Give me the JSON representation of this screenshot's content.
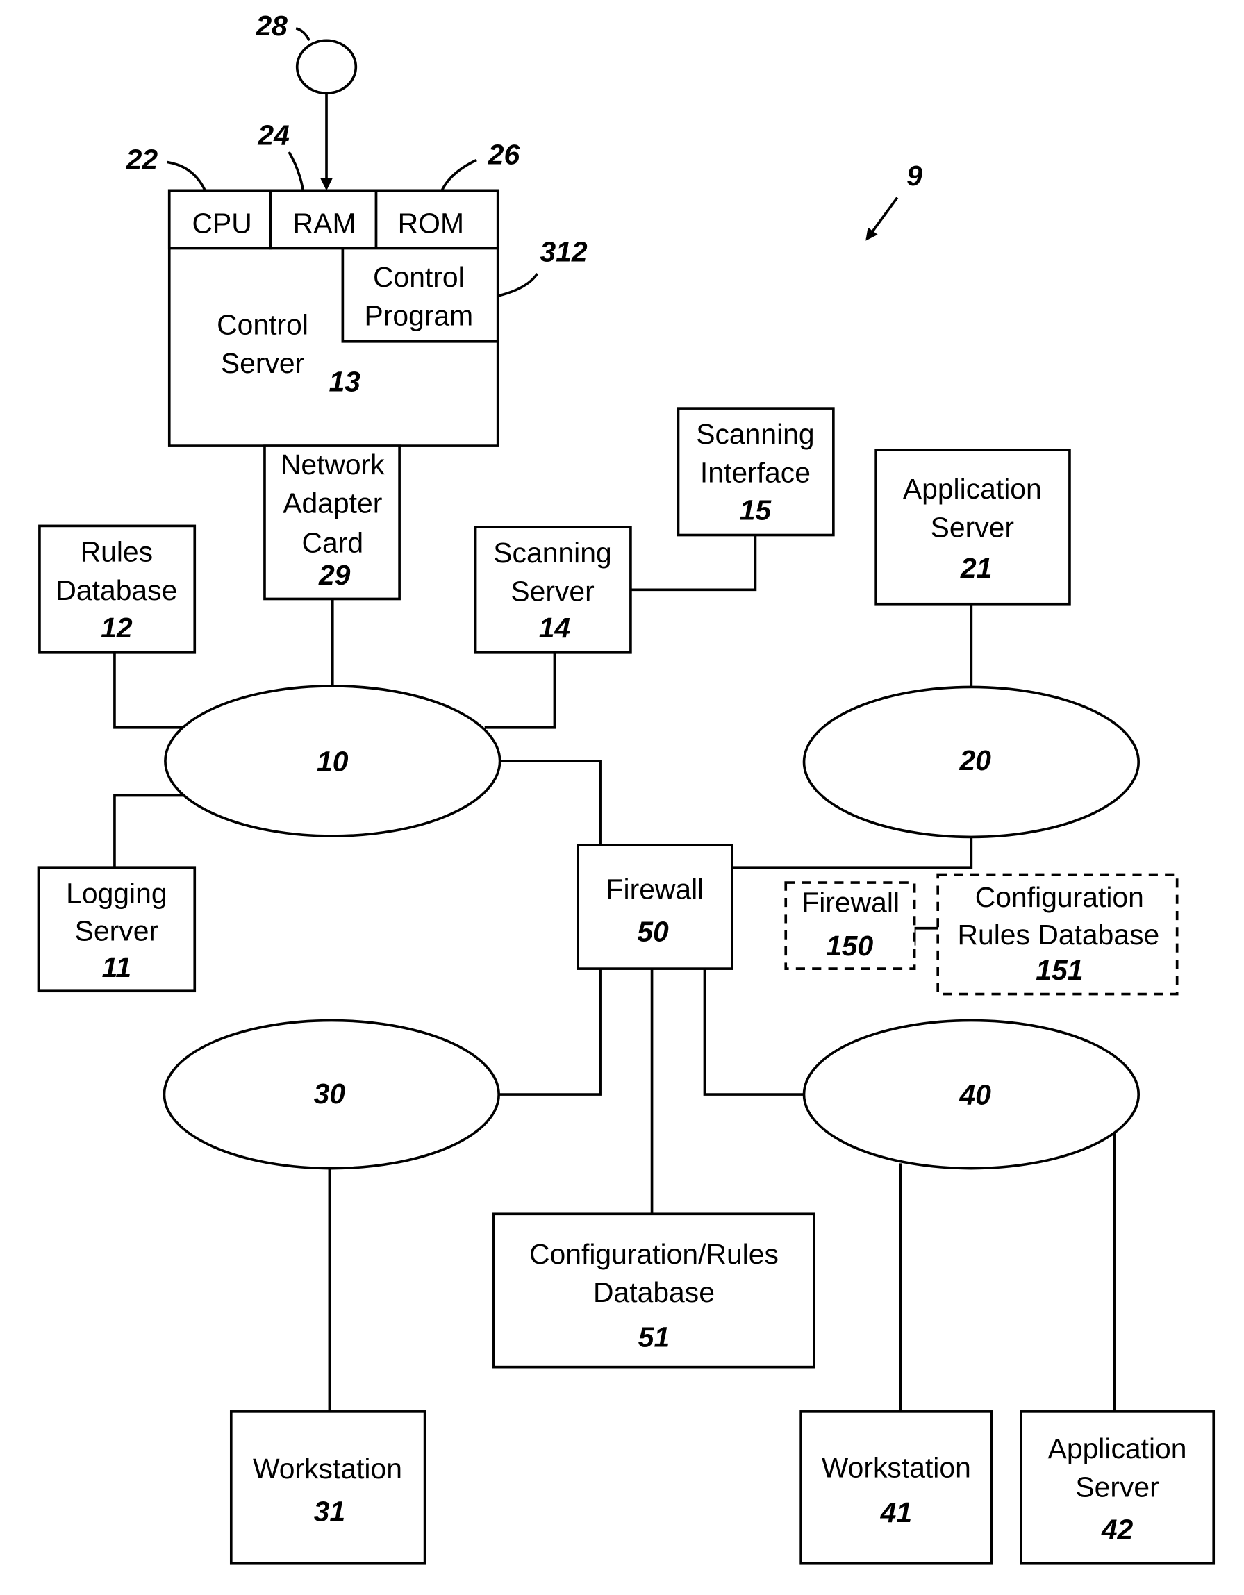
{
  "figure_ref": "9",
  "control_server": {
    "label_line1": "Control",
    "label_line2": "Server",
    "ref": "13"
  },
  "cpu": {
    "label": "CPU",
    "ref": "22"
  },
  "ram": {
    "label": "RAM",
    "ref": "24"
  },
  "rom": {
    "label": "ROM",
    "ref": "26"
  },
  "storage_media": {
    "ref": "28"
  },
  "control_program": {
    "label_line1": "Control",
    "label_line2": "Program",
    "ref": "312"
  },
  "network_adapter": {
    "label_line1": "Network",
    "label_line2": "Adapter",
    "label_line3": "Card",
    "ref": "29"
  },
  "rules_database": {
    "label_line1": "Rules",
    "label_line2": "Database",
    "ref": "12"
  },
  "scanning_server": {
    "label_line1": "Scanning",
    "label_line2": "Server",
    "ref": "14"
  },
  "scanning_interface": {
    "label_line1": "Scanning",
    "label_line2": "Interface",
    "ref": "15"
  },
  "application_server_21": {
    "label_line1": "Application",
    "label_line2": "Server",
    "ref": "21"
  },
  "logging_server": {
    "label_line1": "Logging",
    "label_line2": "Server",
    "ref": "11"
  },
  "networks": {
    "n10": "10",
    "n20": "20",
    "n30": "30",
    "n40": "40"
  },
  "firewall_50": {
    "label": "Firewall",
    "ref": "50"
  },
  "firewall_150": {
    "label": "Firewall",
    "ref": "150"
  },
  "config_rules_db_151": {
    "label_line1": "Configuration",
    "label_line2": "Rules Database",
    "ref": "151"
  },
  "config_rules_db_51": {
    "label_line1": "Configuration/Rules",
    "label_line2": "Database",
    "ref": "51"
  },
  "workstation_31": {
    "label": "Workstation",
    "ref": "31"
  },
  "workstation_41": {
    "label": "Workstation",
    "ref": "41"
  },
  "application_server_42": {
    "label_line1": "Application",
    "label_line2": "Server",
    "ref": "42"
  }
}
